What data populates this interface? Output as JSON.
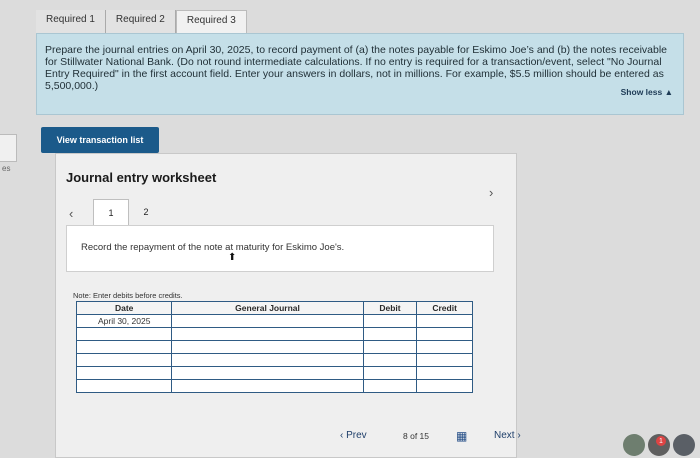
{
  "tabs": {
    "items": [
      {
        "label": "Required 1"
      },
      {
        "label": "Required 2"
      },
      {
        "label": "Required 3"
      }
    ]
  },
  "question": {
    "text": "Prepare the journal entries on April 30, 2025, to record payment of (a) the notes payable for Eskimo Joe’s and (b) the notes receivable for Stillwater National Bank. (Do not round intermediate calculations. If no entry is required for a transaction/event, select \"No Journal Entry Required\" in the first account field. Enter your answers in dollars, not in millions. For example, $5.5 million should be entered as 5,500,000.)",
    "show_less": "Show less ▲"
  },
  "side": {
    "label": "es"
  },
  "actions": {
    "view_transaction_list": "View transaction list"
  },
  "worksheet": {
    "title": "Journal entry worksheet",
    "pages": [
      {
        "label": "1"
      },
      {
        "label": "2"
      }
    ],
    "instruction": "Record the repayment of the note at maturity for Eskimo Joe's.",
    "note": "Note: Enter debits before credits.",
    "table": {
      "headers": {
        "date": "Date",
        "general_journal": "General Journal",
        "debit": "Debit",
        "credit": "Credit"
      },
      "rows": [
        {
          "date": "April 30, 2025",
          "account": "",
          "debit": "",
          "credit": ""
        },
        {
          "date": "",
          "account": "",
          "debit": "",
          "credit": ""
        },
        {
          "date": "",
          "account": "",
          "debit": "",
          "credit": ""
        },
        {
          "date": "",
          "account": "",
          "debit": "",
          "credit": ""
        },
        {
          "date": "",
          "account": "",
          "debit": "",
          "credit": ""
        },
        {
          "date": "",
          "account": "",
          "debit": "",
          "credit": ""
        }
      ]
    }
  },
  "footer": {
    "prev": "Prev",
    "page_info": "8 of 15",
    "next": "Next"
  },
  "dock": {
    "badge": "1"
  }
}
